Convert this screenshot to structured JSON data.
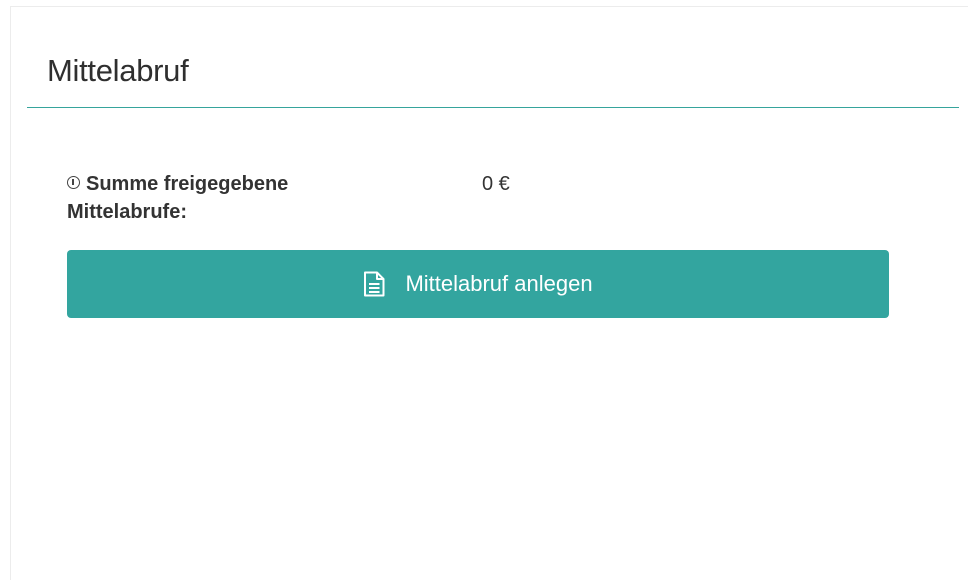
{
  "panel": {
    "title": "Mittelabruf"
  },
  "summary": {
    "label": "Summe freigegebene Mittelabrufe:",
    "value": "0 €"
  },
  "actions": {
    "create_label": "Mittelabruf anlegen"
  },
  "colors": {
    "accent": "#33a59f",
    "divider": "#36a49c",
    "text": "#333333"
  },
  "icons": {
    "info": "info-circle-icon",
    "create": "document-icon"
  }
}
